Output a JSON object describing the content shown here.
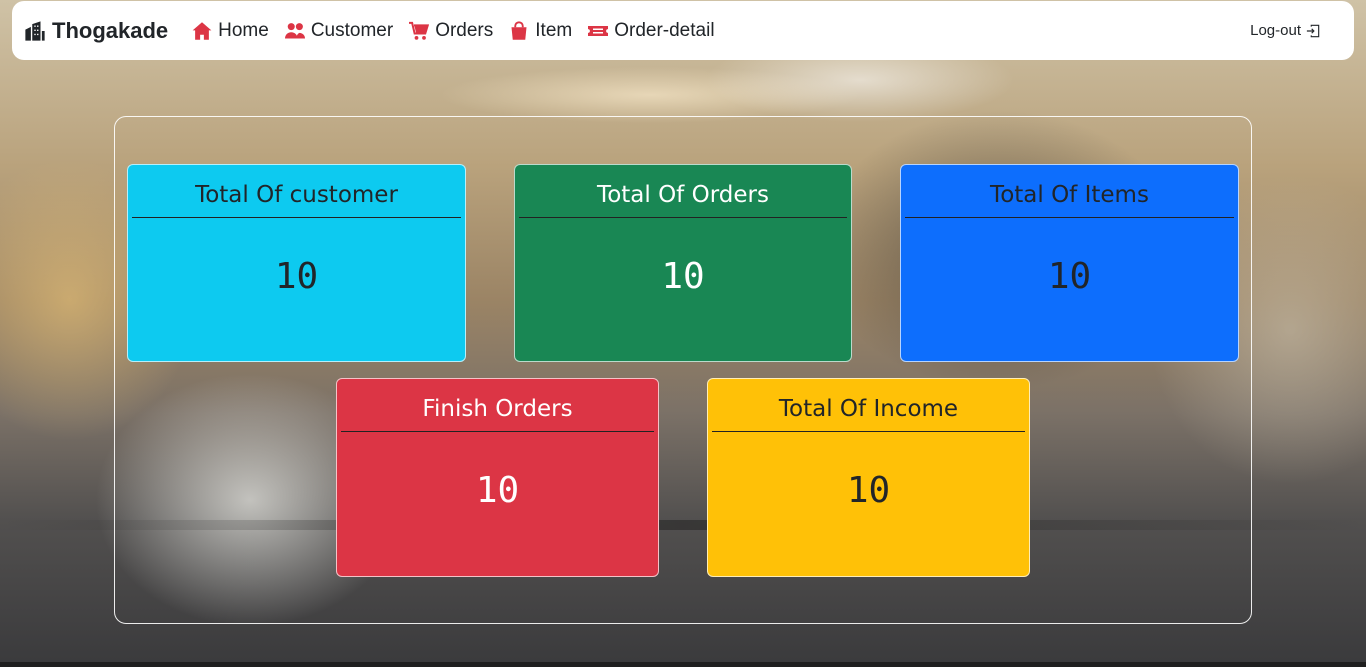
{
  "navbar": {
    "brand": "Thogakade",
    "items": [
      {
        "label": "Home",
        "icon": "house-icon"
      },
      {
        "label": "Customer",
        "icon": "people-icon"
      },
      {
        "label": "Orders",
        "icon": "cart-icon"
      },
      {
        "label": "Item",
        "icon": "bag-icon"
      },
      {
        "label": "Order-detail",
        "icon": "ticket-icon"
      }
    ],
    "logout_label": "Log-out",
    "accent_color": "#dc3545"
  },
  "dashboard": {
    "cards": [
      {
        "title": "Total Of customer",
        "value": "10",
        "color": "#0dcaf0"
      },
      {
        "title": "Total Of Orders",
        "value": "10",
        "color": "#198754"
      },
      {
        "title": "Total Of Items",
        "value": "10",
        "color": "#0d6efd"
      },
      {
        "title": "Finish Orders",
        "value": "10",
        "color": "#dc3545"
      },
      {
        "title": "Total Of Income",
        "value": "10",
        "color": "#ffc107"
      }
    ]
  }
}
